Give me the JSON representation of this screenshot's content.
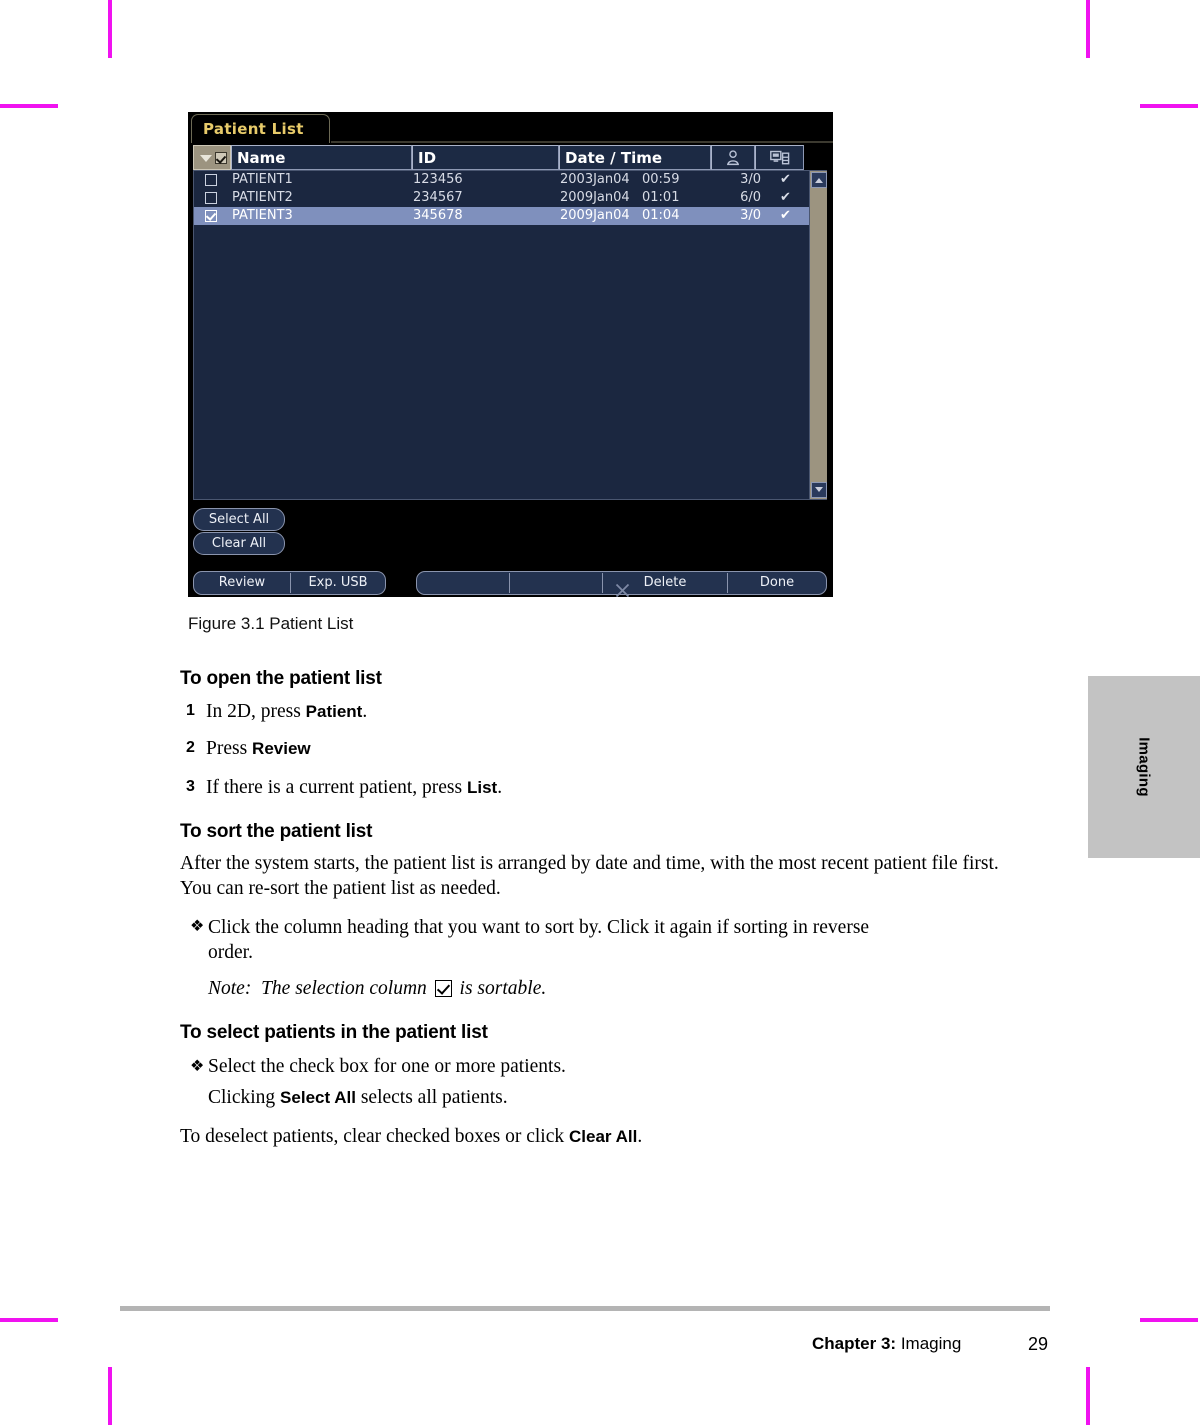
{
  "crop_marks_color": "#f012f0",
  "side_tab": {
    "label": "Imaging",
    "background": "#c3c3c3"
  },
  "figure": {
    "tab_label": "Patient List",
    "accent_color": "#e8cb6a",
    "panel_background": "#000000",
    "list_background": "#1b2740",
    "selected_row_color": "#7f90bd",
    "columns": [
      {
        "key": "select",
        "label": "",
        "icon": "checkbox-sort-header"
      },
      {
        "key": "name",
        "label": "Name"
      },
      {
        "key": "id",
        "label": "ID"
      },
      {
        "key": "date",
        "label": "Date / Time"
      },
      {
        "key": "user",
        "label": "",
        "icon": "user-icon"
      },
      {
        "key": "study",
        "label": "",
        "icon": "study-archive-icon"
      }
    ],
    "rows": [
      {
        "checked": false,
        "selected": false,
        "name": "PATIENT1",
        "id": "123456",
        "date": "2003Jan04",
        "time": "00:59",
        "count": "3/0",
        "mark": "✔"
      },
      {
        "checked": false,
        "selected": false,
        "name": "PATIENT2",
        "id": "234567",
        "date": "2009Jan04",
        "time": "01:01",
        "count": "6/0",
        "mark": "✔"
      },
      {
        "checked": true,
        "selected": true,
        "name": "PATIENT3",
        "id": "345678",
        "date": "2009Jan04",
        "time": "01:04",
        "count": "3/0",
        "mark": "✔"
      }
    ],
    "side_buttons": {
      "select_all": "Select All",
      "clear_all": "Clear All"
    },
    "bottom_bar": {
      "left_group": [
        "Review",
        "Exp. USB"
      ],
      "right_group": [
        "",
        "",
        "Delete",
        "Done"
      ],
      "delete_icon": "close-x-icon"
    },
    "scrollbar": {
      "up_icon": "scroll-up-arrow",
      "down_icon": "scroll-down-arrow",
      "track_color": "#9c9480"
    }
  },
  "caption": "Figure 3.1  Patient List",
  "sections": {
    "open": {
      "heading": "To open the patient list",
      "steps": [
        {
          "num": "1",
          "pre": "In 2D, press ",
          "strong": "Patient",
          "post": "."
        },
        {
          "num": "2",
          "pre": "Press ",
          "strong": "Review",
          "post": ""
        },
        {
          "num": "3",
          "pre": "If there is a current patient, press ",
          "strong": "List",
          "post": "."
        }
      ]
    },
    "sort": {
      "heading": "To sort the patient list",
      "paragraph": "After the system starts, the patient list is arranged by date and time, with the most recent patient file first. You can re-sort the patient list as needed.",
      "bullet_symbol": "❖",
      "bullet": "Click the column heading that you want to sort by. Click it again if sorting in reverse order.",
      "note_label": "Note:",
      "note_pre": "The selection column",
      "note_post": "is sortable.",
      "note_icon": "selection-column-checkbox-icon"
    },
    "select": {
      "heading": "To select patients in the patient list",
      "bullet_symbol": "❖",
      "bullet": "Select the check box for one or more patients.",
      "sub_pre": "Clicking ",
      "sub_strong": "Select All",
      "sub_post": " selects all patients.",
      "closing_pre": "To deselect patients, clear checked boxes or click ",
      "closing_strong": "Clear All",
      "closing_post": "."
    }
  },
  "footer": {
    "chapter_label": "Chapter 3:",
    "chapter_name": "Imaging",
    "page_number": "29"
  }
}
